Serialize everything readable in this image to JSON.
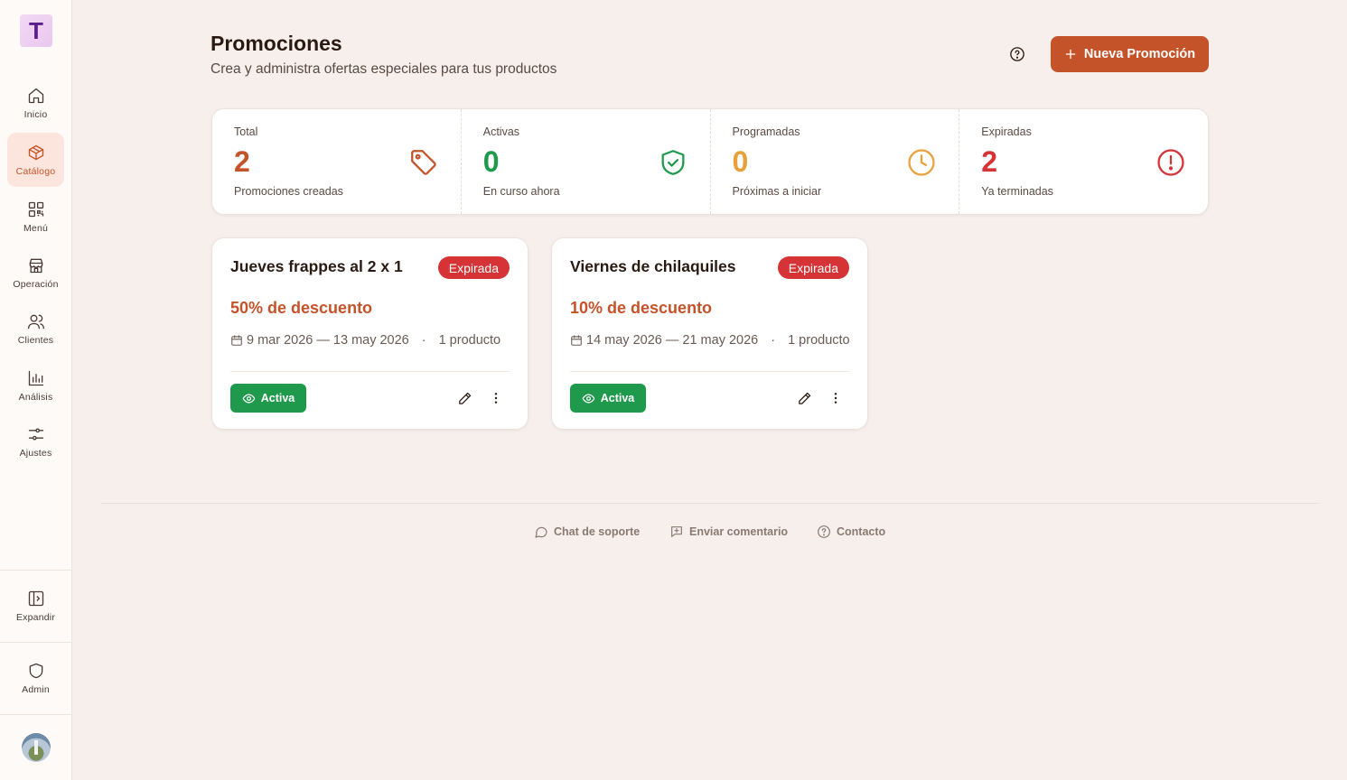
{
  "sidebar": {
    "logo_letter": "T",
    "items": [
      {
        "label": "Inicio",
        "icon": "home-icon"
      },
      {
        "label": "Catálogo",
        "icon": "box-icon"
      },
      {
        "label": "Menú",
        "icon": "qr-icon"
      },
      {
        "label": "Operación",
        "icon": "store-icon"
      },
      {
        "label": "Clientes",
        "icon": "users-icon"
      },
      {
        "label": "Análisis",
        "icon": "bar-chart-icon"
      },
      {
        "label": "Ajustes",
        "icon": "sliders-icon"
      }
    ],
    "expand_label": "Expandir",
    "admin_label": "Admin"
  },
  "header": {
    "title": "Promociones",
    "subtitle": "Crea y administra ofertas especiales para tus productos",
    "new_button": "Nueva Promoción"
  },
  "stats": [
    {
      "label": "Total",
      "value": "2",
      "desc": "Promociones creadas",
      "color": "#c4532a",
      "icon": "tag-icon"
    },
    {
      "label": "Activas",
      "value": "0",
      "desc": "En curso ahora",
      "color": "#1f9a4c",
      "icon": "shield-check-icon"
    },
    {
      "label": "Programadas",
      "value": "0",
      "desc": "Próximas a iniciar",
      "color": "#e8a13a",
      "icon": "clock-icon"
    },
    {
      "label": "Expiradas",
      "value": "2",
      "desc": "Ya terminadas",
      "color": "#d63336",
      "icon": "alert-circle-icon"
    }
  ],
  "promotions": [
    {
      "title": "Jueves frappes al 2 x 1",
      "status_badge": "Expirada",
      "discount": "50% de descuento",
      "dates": "9 mar 2026 — 13 may 2026",
      "separator": "·",
      "products": "1 producto",
      "active_label": "Activa"
    },
    {
      "title": "Viernes de chilaquiles",
      "status_badge": "Expirada",
      "discount": "10% de descuento",
      "dates": "14 may 2026 — 21 may 2026",
      "separator": "·",
      "products": "1 producto",
      "active_label": "Activa"
    }
  ],
  "footer": {
    "support": "Chat de soporte",
    "feedback": "Enviar comentario",
    "contact": "Contacto"
  }
}
